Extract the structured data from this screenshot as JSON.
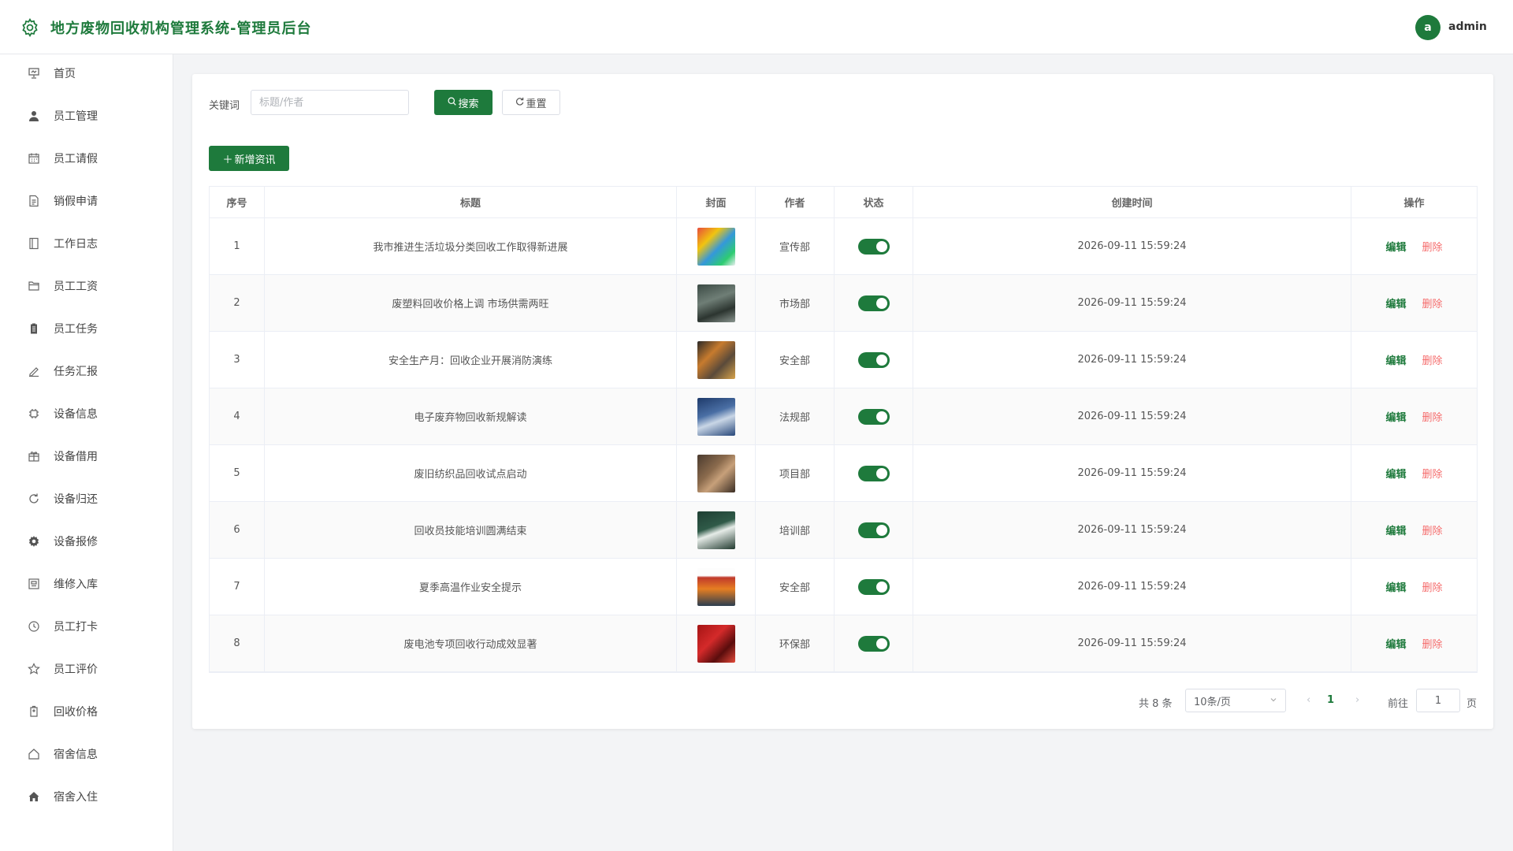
{
  "header": {
    "title": "地方废物回收机构管理系统-管理员后台",
    "avatar_letter": "a",
    "username": "admin"
  },
  "sidebar": {
    "items": [
      {
        "label": "首页",
        "icon": "presentation-icon"
      },
      {
        "label": "员工管理",
        "icon": "user-icon"
      },
      {
        "label": "员工请假",
        "icon": "calendar-icon"
      },
      {
        "label": "销假申请",
        "icon": "document-icon"
      },
      {
        "label": "工作日志",
        "icon": "notebook-icon"
      },
      {
        "label": "员工工资",
        "icon": "folder-icon"
      },
      {
        "label": "员工任务",
        "icon": "clipboard-icon"
      },
      {
        "label": "任务汇报",
        "icon": "edit-pen-icon"
      },
      {
        "label": "设备信息",
        "icon": "chip-icon"
      },
      {
        "label": "设备借用",
        "icon": "gift-box-icon"
      },
      {
        "label": "设备归还",
        "icon": "refresh-icon"
      },
      {
        "label": "设备报修",
        "icon": "gear-icon"
      },
      {
        "label": "维修入库",
        "icon": "warehouse-icon"
      },
      {
        "label": "员工打卡",
        "icon": "clock-icon"
      },
      {
        "label": "员工评价",
        "icon": "star-icon"
      },
      {
        "label": "回收价格",
        "icon": "price-tag-icon"
      },
      {
        "label": "宿舍信息",
        "icon": "house-outline-icon"
      },
      {
        "label": "宿舍入住",
        "icon": "house-filled-icon"
      }
    ]
  },
  "search": {
    "label": "关键词",
    "placeholder": "标题/作者",
    "value": "",
    "search_label": "搜索",
    "reset_label": "重置",
    "add_label": "新增资讯"
  },
  "table": {
    "headers": [
      "序号",
      "标题",
      "封面",
      "作者",
      "状态",
      "创建时间",
      "操作"
    ],
    "edit_label": "编辑",
    "delete_label": "删除",
    "rows": [
      {
        "idx": "1",
        "title": "我市推进生活垃圾分类回收工作取得新进展",
        "author": "宣传部",
        "time": "2026-09-11 15:59:24",
        "status_on": true
      },
      {
        "idx": "2",
        "title": "废塑料回收价格上调 市场供需两旺",
        "author": "市场部",
        "time": "2026-09-11 15:59:24",
        "status_on": true
      },
      {
        "idx": "3",
        "title": "安全生产月：回收企业开展消防演练",
        "author": "安全部",
        "time": "2026-09-11 15:59:24",
        "status_on": true
      },
      {
        "idx": "4",
        "title": "电子废弃物回收新规解读",
        "author": "法规部",
        "time": "2026-09-11 15:59:24",
        "status_on": true
      },
      {
        "idx": "5",
        "title": "废旧纺织品回收试点启动",
        "author": "项目部",
        "time": "2026-09-11 15:59:24",
        "status_on": true
      },
      {
        "idx": "6",
        "title": "回收员技能培训圆满结束",
        "author": "培训部",
        "time": "2026-09-11 15:59:24",
        "status_on": true
      },
      {
        "idx": "7",
        "title": "夏季高温作业安全提示",
        "author": "安全部",
        "time": "2026-09-11 15:59:24",
        "status_on": true
      },
      {
        "idx": "8",
        "title": "废电池专项回收行动成效显著",
        "author": "环保部",
        "time": "2026-09-11 15:59:24",
        "status_on": true
      }
    ]
  },
  "pagination": {
    "total_text": "共 8 条",
    "page_size": "10条/页",
    "current_page": "1",
    "goto_label": "前往",
    "goto_value": "1",
    "page_unit": "页"
  },
  "colors": {
    "accent": "#1e7a3c",
    "danger": "#f56c6c"
  }
}
